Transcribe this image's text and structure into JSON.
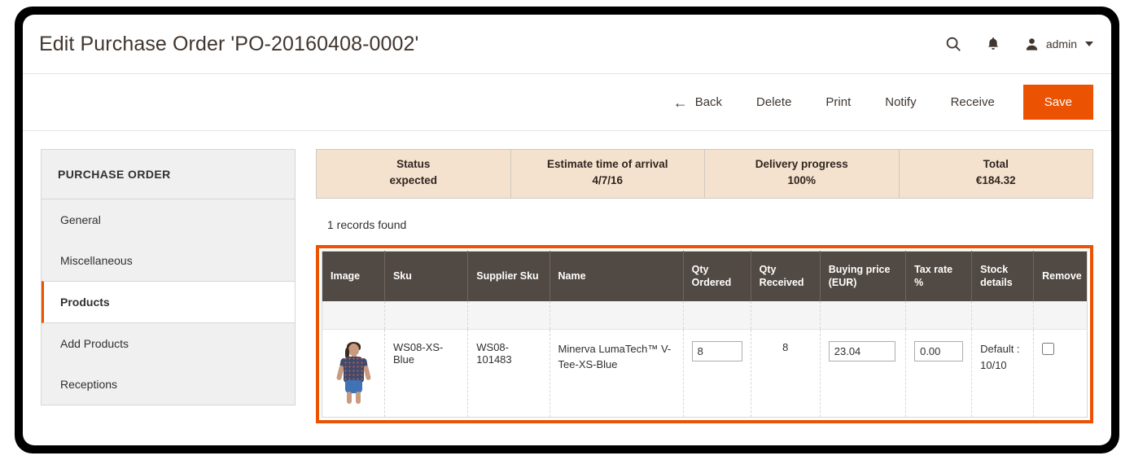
{
  "header": {
    "title": "Edit Purchase Order 'PO-20160408-0002'",
    "search_icon": "search-icon",
    "notifications_icon": "bell-icon",
    "user_icon": "user-avatar-icon",
    "admin_label": "admin"
  },
  "toolbar": {
    "back_arrow": "←",
    "back_label": "Back",
    "delete_label": "Delete",
    "print_label": "Print",
    "notify_label": "Notify",
    "receive_label": "Receive",
    "save_label": "Save",
    "save_color": "#eb5202"
  },
  "sidebar": {
    "title": "PURCHASE ORDER",
    "items": [
      {
        "label": "General",
        "active": false
      },
      {
        "label": "Miscellaneous",
        "active": false
      },
      {
        "label": "Products",
        "active": true
      },
      {
        "label": "Add Products",
        "active": false
      },
      {
        "label": "Receptions",
        "active": false
      }
    ],
    "active_accent": "#eb5202"
  },
  "status_bar": {
    "background": "#f5e2ce",
    "cells": [
      {
        "label": "Status",
        "value": "expected"
      },
      {
        "label": "Estimate time of arrival",
        "value": "4/7/16"
      },
      {
        "label": "Delivery progress",
        "value": "100%"
      },
      {
        "label": "Total",
        "value": "€184.32"
      }
    ]
  },
  "main": {
    "records_found": "1 records found",
    "highlight_color": "#eb5202",
    "table": {
      "header_background": "#514943",
      "columns": [
        "Image",
        "Sku",
        "Supplier Sku",
        "Name",
        "Qty Ordered",
        "Qty Received",
        "Buying price (EUR)",
        "Tax rate %",
        "Stock details",
        "Remove"
      ],
      "rows": [
        {
          "image": "product-thumbnail-minerva-lumatech-v-tee",
          "sku": "WS08-XS-Blue",
          "supplier_sku": "WS08-101483",
          "name": "Minerva LumaTech™ V-Tee-XS-Blue",
          "qty_ordered": "8",
          "qty_received": "8",
          "buying_price": "23.04",
          "tax_rate": "0.00",
          "stock_details_label": "Default :",
          "stock_details_value": "10/10",
          "remove_checked": false
        }
      ]
    }
  }
}
